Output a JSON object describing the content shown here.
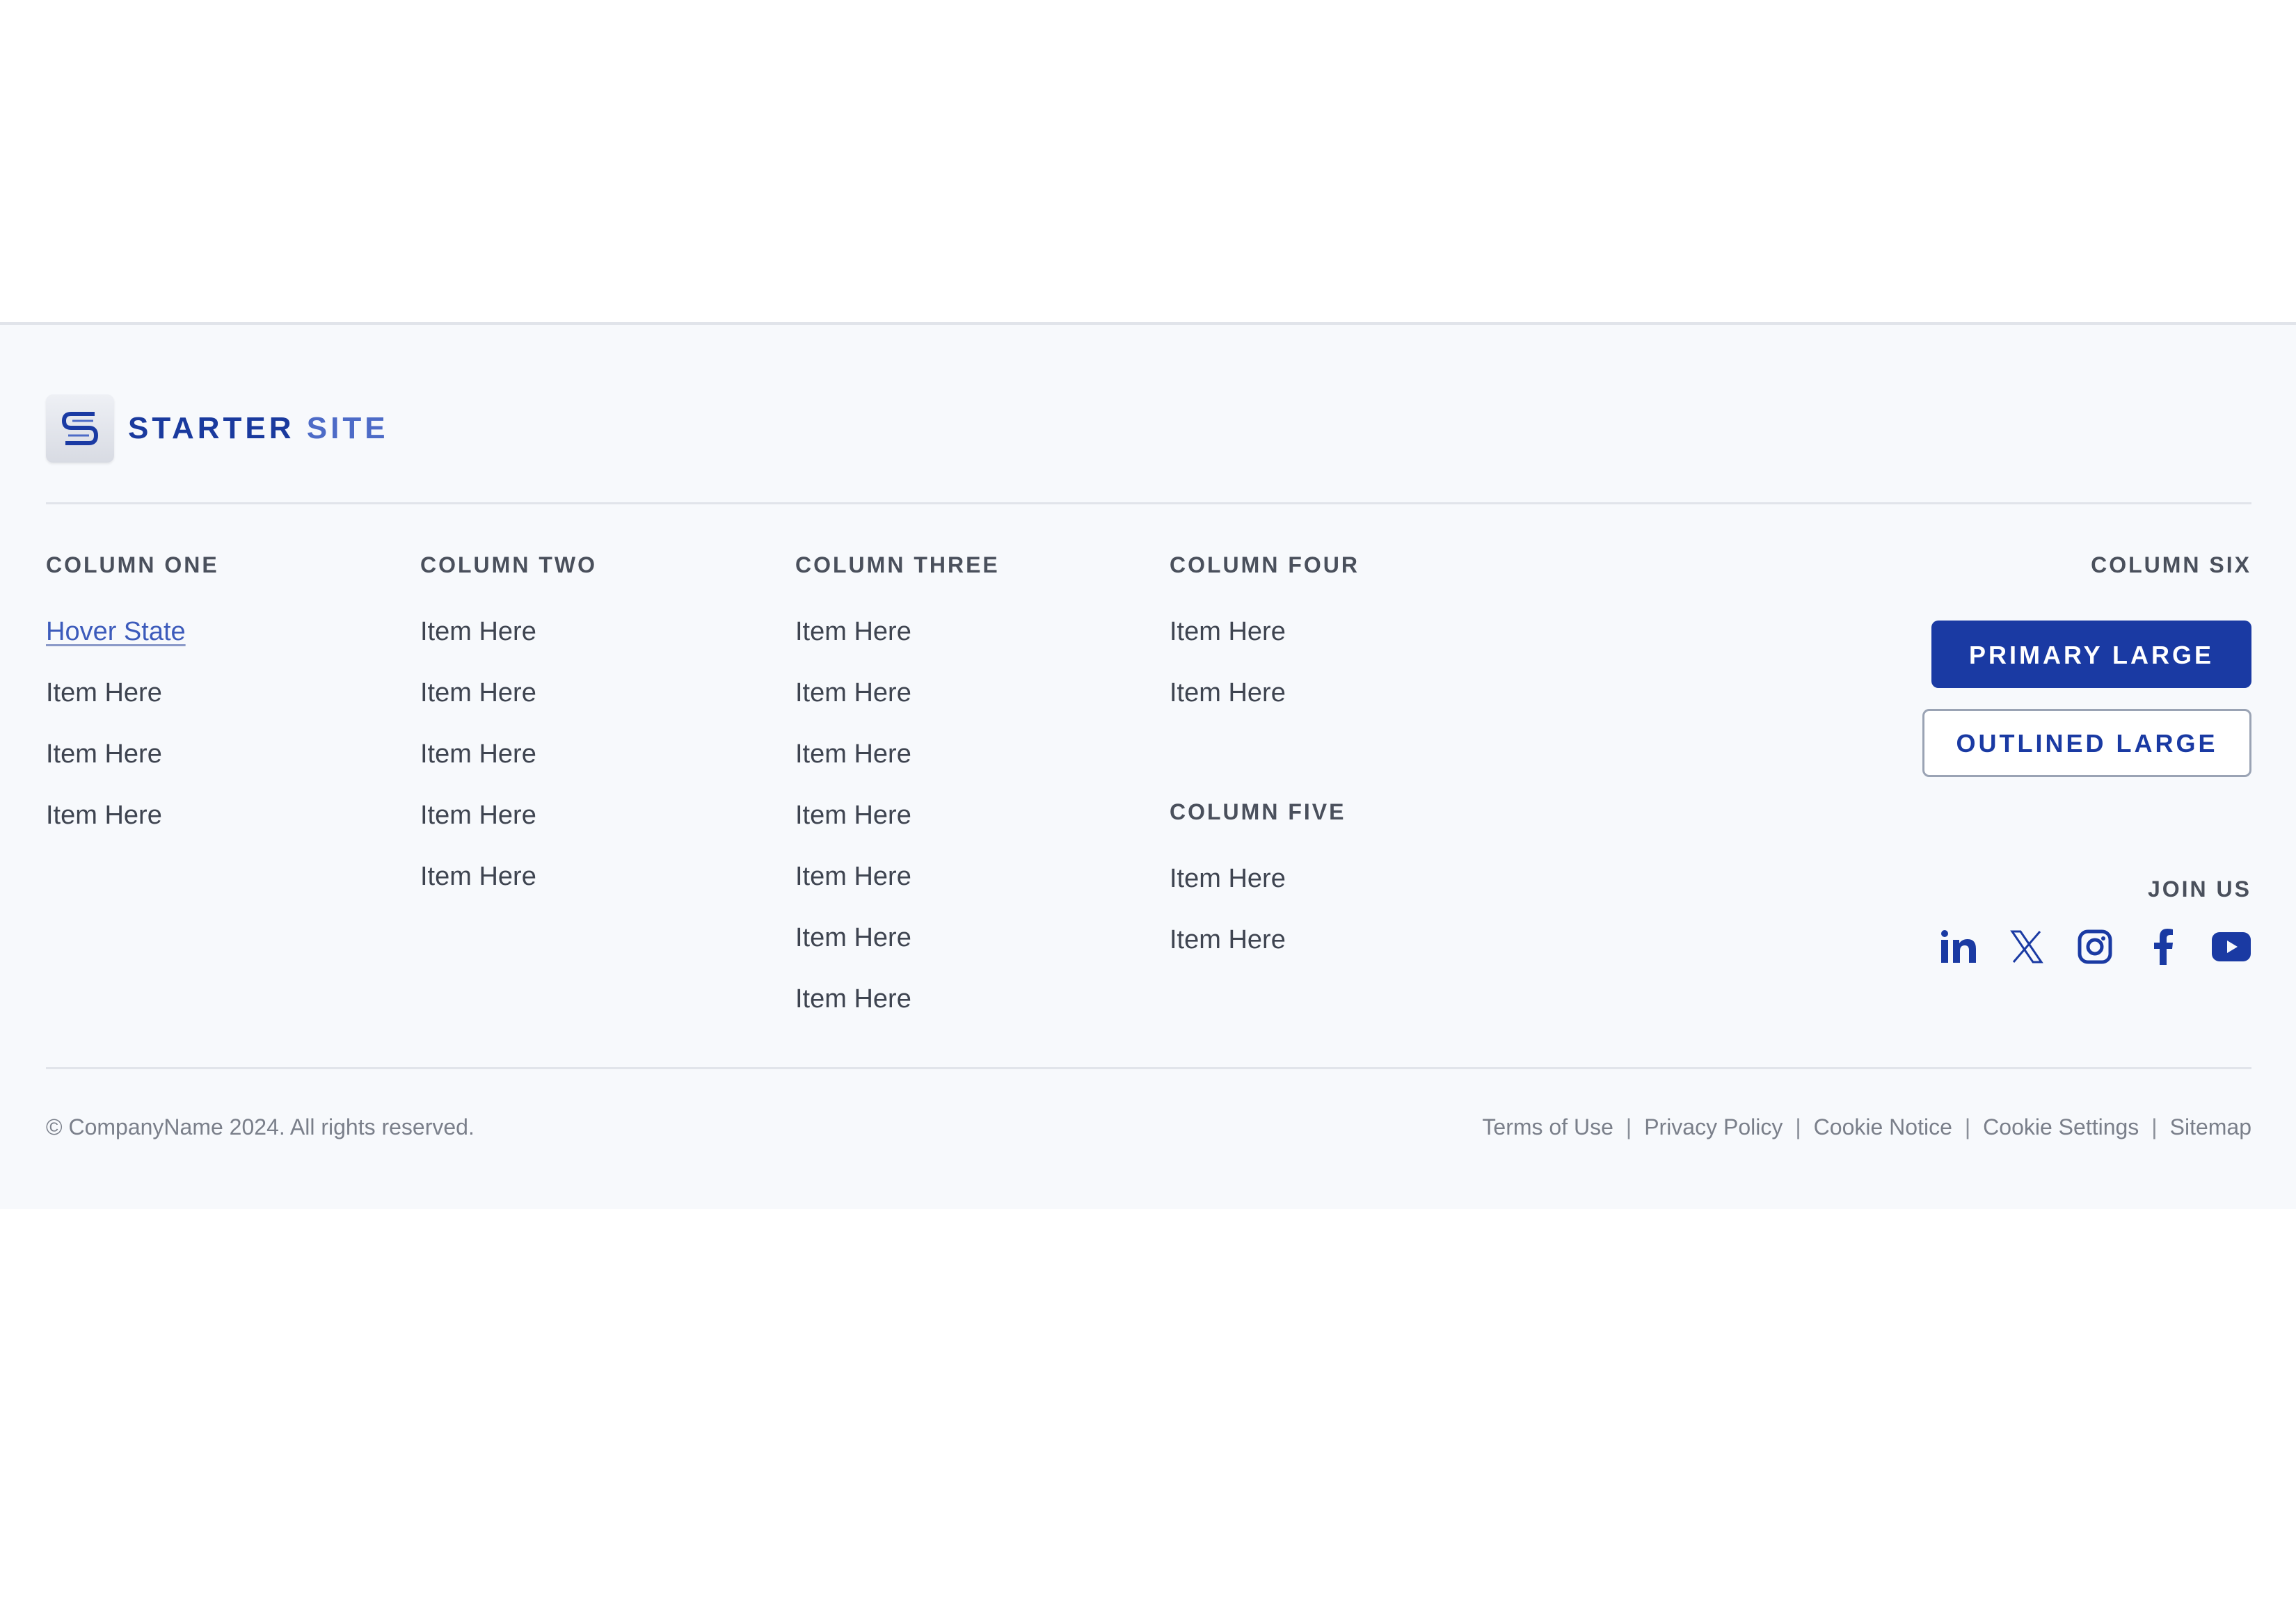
{
  "brand": {
    "name_part1": "STARTER",
    "name_part2": "SITE",
    "logo_icon": "s-logo-icon",
    "colors": {
      "primary": "#1a3aa3",
      "brand_dark": "#1a3a9e",
      "brand_light": "#4d6bc7",
      "link_hover": "#3c5bbb"
    }
  },
  "columns": [
    {
      "heading": "COLUMN ONE",
      "items": [
        "Hover State",
        "Item Here",
        "Item Here",
        "Item Here"
      ]
    },
    {
      "heading": "COLUMN TWO",
      "items": [
        "Item Here",
        "Item Here",
        "Item Here",
        "Item Here",
        "Item Here"
      ]
    },
    {
      "heading": "COLUMN THREE",
      "items": [
        "Item Here",
        "Item Here",
        "Item Here",
        "Item Here",
        "Item Here",
        "Item Here",
        "Item Here"
      ]
    },
    {
      "heading": "COLUMN FOUR",
      "items": [
        "Item Here",
        "Item Here"
      ]
    },
    {
      "heading": "COLUMN FIVE",
      "items": [
        "Item Here",
        "Item Here"
      ]
    }
  ],
  "column_six": {
    "heading": "COLUMN SIX",
    "primary_button": "PRIMARY LARGE",
    "outlined_button": "OUTLINED LARGE",
    "join_heading": "JOIN US",
    "socials": [
      "linkedin-icon",
      "x-icon",
      "instagram-icon",
      "facebook-icon",
      "youtube-icon"
    ]
  },
  "bottom": {
    "copyright": "© CompanyName 2024. All rights reserved.",
    "separator": "|",
    "links": [
      "Terms of Use",
      "Privacy Policy",
      "Cookie Notice",
      "Cookie Settings",
      "Sitemap"
    ]
  }
}
